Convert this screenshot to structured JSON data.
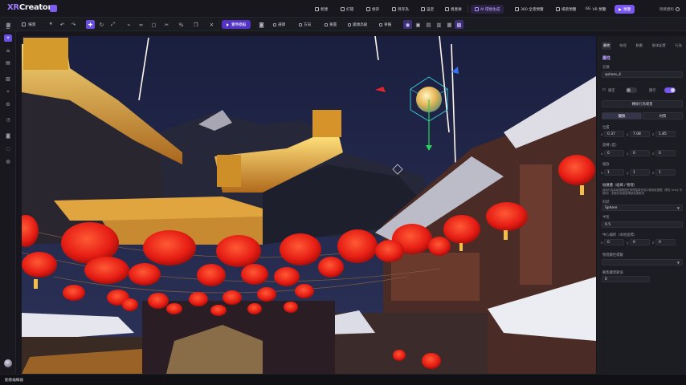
{
  "app": {
    "logo_prefix": "XR",
    "logo_name": "Creator"
  },
  "topbar": {
    "items": [
      "新建",
      "打開",
      "保存",
      "另存為",
      "設定",
      "資產庫"
    ],
    "ai_label": "AI 環境生成",
    "panorama_label": "360 全景預覽",
    "vr_label": "VR 預覽",
    "vr_prefix": "6G",
    "preview_label": "預覽",
    "share_label": "場景預覽",
    "account_label": "項目資料"
  },
  "toolbar": {
    "scene_label": "場景",
    "record_label": "實時模擬",
    "tools": [
      "選擇",
      "方向",
      "重置",
      "鏡頭高級",
      "骨骼"
    ]
  },
  "rpanel": {
    "tabs": [
      "屬性",
      "物理",
      "動畫",
      "腳本配置",
      "行為"
    ],
    "section_title": "屬性",
    "name_label": "名稱",
    "name_value": "sphere_4",
    "lock_label": "鎖定",
    "visible_label": "顯示",
    "convert_label": "轉換行為場景",
    "mode_a": "變換",
    "mode_b": "材質",
    "position_label": "位置",
    "position": [
      "0.37",
      "7.08",
      "1.85"
    ],
    "rotation_label": "旋轉 (度)",
    "rotation": [
      "0",
      "0",
      "0"
    ],
    "scale_label": "縮放",
    "scale": [
      "1",
      "1",
      "1"
    ],
    "collider_label": "碰撞體（組織 / 物理）",
    "collider_note": "啟用行為為碰撞範圍在物理運算形成中使用碰撞體（需在 Unity 中使用）,表面初始運動場景碰撞應用",
    "shape_label": "形狀",
    "shape_value": "Sphere",
    "radius_label": "半徑",
    "radius_value": "0.5",
    "center_label": "中心偏移（本地座標）",
    "center": [
      "0",
      "0",
      "0"
    ],
    "physics_label": "物理屬性標籤",
    "mass_label": "動態觸發數值",
    "mass_value": "0"
  },
  "status": {
    "text": "動態編輯器"
  },
  "colors": {
    "accent": "#7b57f2",
    "lantern": "#e8231a",
    "sky": "#1c2240"
  }
}
